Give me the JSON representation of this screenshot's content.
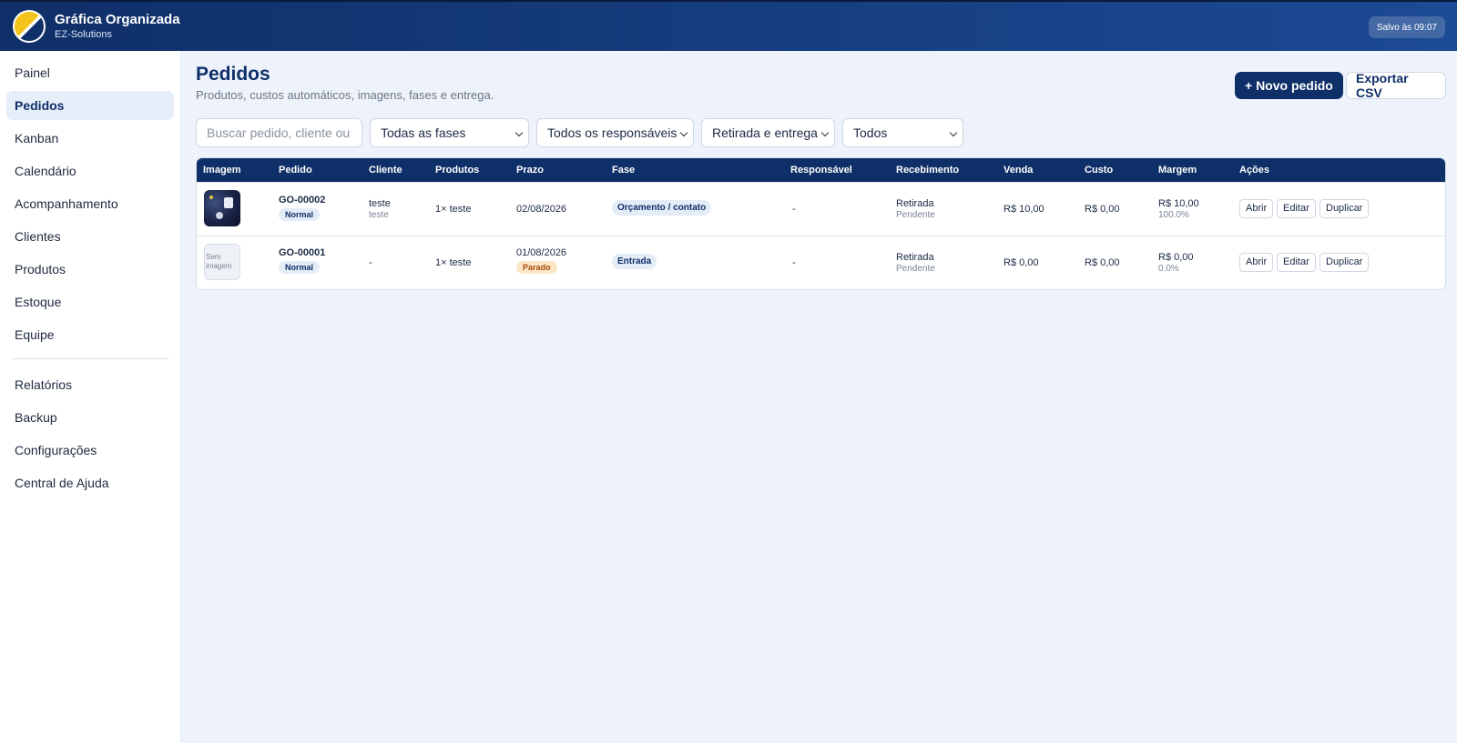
{
  "app": {
    "title": "Gráfica Organizada",
    "subtitle": "EZ-Solutions",
    "saved_status": "Salvo às 09:07"
  },
  "sidebar": {
    "items": [
      {
        "label": "Painel",
        "active": false
      },
      {
        "label": "Pedidos",
        "active": true
      },
      {
        "label": "Kanban",
        "active": false
      },
      {
        "label": "Calendário",
        "active": false
      },
      {
        "label": "Acompanhamento",
        "active": false
      },
      {
        "label": "Clientes",
        "active": false
      },
      {
        "label": "Produtos",
        "active": false
      },
      {
        "label": "Estoque",
        "active": false
      },
      {
        "label": "Equipe",
        "active": false
      }
    ],
    "secondary_items": [
      {
        "label": "Relatórios"
      },
      {
        "label": "Backup"
      },
      {
        "label": "Configurações"
      },
      {
        "label": "Central de Ajuda"
      }
    ]
  },
  "page": {
    "title": "Pedidos",
    "subtitle": "Produtos, custos automáticos, imagens, fases e entrega."
  },
  "actions": {
    "new_order": "+ Novo pedido",
    "export_csv": "Exportar CSV"
  },
  "filters": {
    "search_placeholder": "Buscar pedido, cliente ou produto",
    "phase": "Todas as fases",
    "owner": "Todos os responsáveis",
    "delivery": "Retirada e entrega",
    "status": "Todos"
  },
  "table": {
    "columns": [
      "Imagem",
      "Pedido",
      "Cliente",
      "Produtos",
      "Prazo",
      "Fase",
      "Responsável",
      "Recebimento",
      "Venda",
      "Custo",
      "Margem",
      "Ações"
    ],
    "rows": [
      {
        "image": "order-thumbnail",
        "no_image_label": "",
        "order_id": "GO-00002",
        "priority": "Normal",
        "client": "teste",
        "client_sub": "teste",
        "products": "1× teste",
        "deadline": "02/08/2026",
        "deadline_flag": "",
        "phase": "Orçamento / contato",
        "owner": "-",
        "receipt": "Retirada",
        "receipt_status": "Pendente",
        "sale": "R$ 10,00",
        "cost": "R$ 0,00",
        "margin": "R$ 10,00",
        "margin_pct": "100.0%",
        "actions": [
          "Abrir",
          "Editar",
          "Duplicar"
        ]
      },
      {
        "image": "none",
        "no_image_label": "Sem imagem",
        "order_id": "GO-00001",
        "priority": "Normal",
        "client": "-",
        "client_sub": "",
        "products": "1× teste",
        "deadline": "01/08/2026",
        "deadline_flag": "Parado",
        "phase": "Entrada",
        "owner": "-",
        "receipt": "Retirada",
        "receipt_status": "Pendente",
        "sale": "R$ 0,00",
        "cost": "R$ 0,00",
        "margin": "R$ 0,00",
        "margin_pct": "0.0%",
        "actions": [
          "Abrir",
          "Editar",
          "Duplicar"
        ]
      }
    ]
  },
  "colors": {
    "primary": "#0f2f68",
    "background": "#eef3fb",
    "badge_orange": "#fde6c8"
  }
}
